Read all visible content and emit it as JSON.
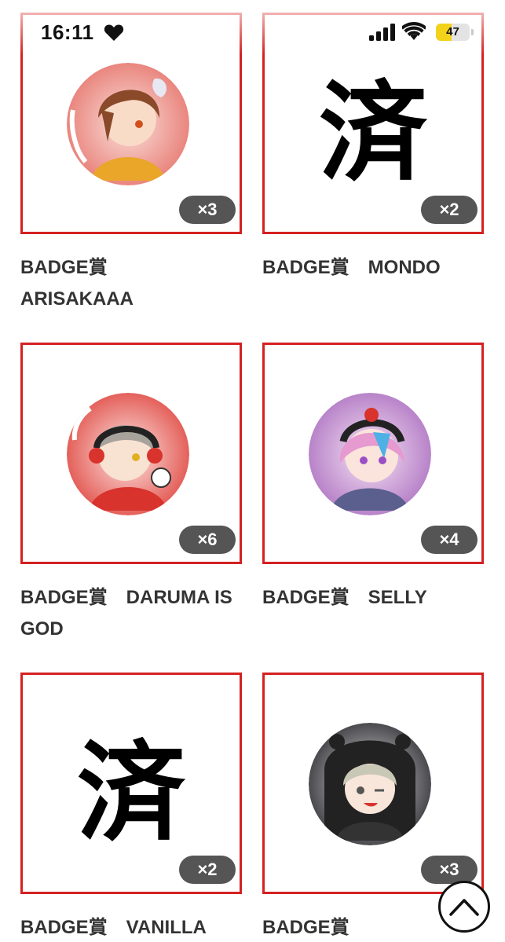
{
  "status_bar": {
    "time": "16:11",
    "heart_icon": "heart-icon",
    "signal_icon": "cellular-signal-icon",
    "wifi_icon": "wifi-icon",
    "battery_level": 47,
    "battery_text": "47",
    "battery_color": "#f2d21b"
  },
  "accent_color": "#d42121",
  "items": [
    {
      "title": "BADGE賞\nARISAKAAA",
      "count": "×3",
      "image": "badge-arisakaaa",
      "completed": false
    },
    {
      "title": "BADGE賞　MONDO",
      "count": "×2",
      "image": null,
      "completed": true,
      "done_text": "済"
    },
    {
      "title": "BADGE賞　DARUMA IS GOD",
      "count": "×6",
      "image": "badge-daruma",
      "completed": false
    },
    {
      "title": "BADGE賞　SELLY",
      "count": "×4",
      "image": "badge-selly",
      "completed": false
    },
    {
      "title": "BADGE賞　VANILLA",
      "count": "×2",
      "image": null,
      "completed": true,
      "done_text": "済"
    },
    {
      "title": "BADGE賞",
      "count": "×3",
      "image": "badge-tototmix",
      "completed": false
    }
  ],
  "scroll_top_icon": "chevron-up-icon"
}
